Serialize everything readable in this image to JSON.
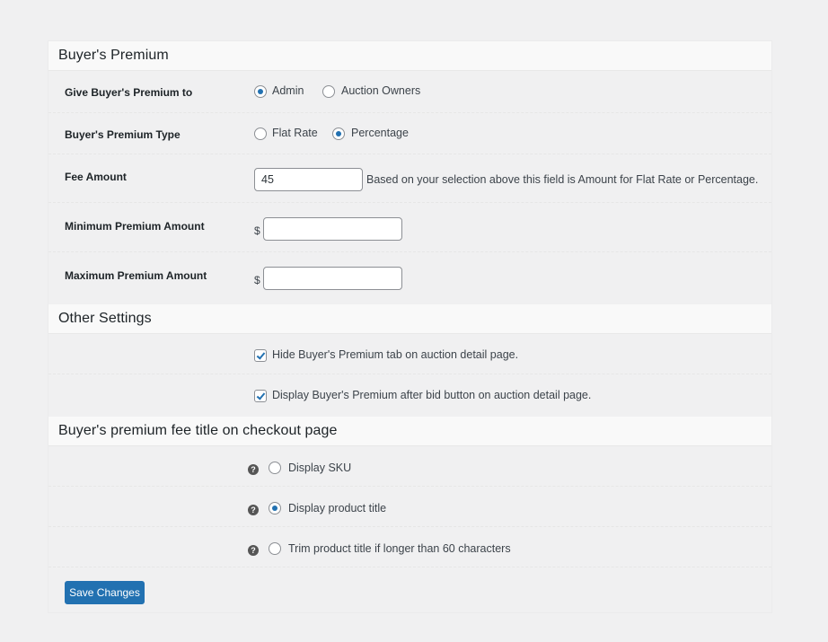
{
  "sections": {
    "buyers_premium": {
      "title": "Buyer's Premium",
      "give_to": {
        "label": "Give Buyer's Premium to",
        "options": [
          {
            "label": "Admin",
            "selected": true
          },
          {
            "label": "Auction Owners",
            "selected": false
          }
        ]
      },
      "type": {
        "label": "Buyer's Premium Type",
        "options": [
          {
            "label": "Flat Rate",
            "selected": false
          },
          {
            "label": "Percentage",
            "selected": true
          }
        ]
      },
      "fee_amount": {
        "label": "Fee Amount",
        "value": "45",
        "description": "Based on your selection above this field is Amount for Flat Rate or Percentage."
      },
      "minimum": {
        "label": "Minimum Premium Amount",
        "currency": "$",
        "value": ""
      },
      "maximum": {
        "label": "Maximum Premium Amount",
        "currency": "$",
        "value": ""
      }
    },
    "other_settings": {
      "title": "Other Settings",
      "checkboxes": [
        {
          "label": "Hide Buyer's Premium tab on auction detail page.",
          "checked": true
        },
        {
          "label": "Display Buyer's Premium after bid button on auction detail page.",
          "checked": true
        }
      ]
    },
    "checkout_title": {
      "title": "Buyer's premium fee title on checkout page",
      "help_icon": "?",
      "options": [
        {
          "label": "Display SKU",
          "selected": false
        },
        {
          "label": "Display product title",
          "selected": true
        },
        {
          "label": "Trim product title if longer than 60 characters",
          "selected": false
        }
      ]
    }
  },
  "actions": {
    "save_label": "Save Changes"
  },
  "colors": {
    "accent": "#2271b1",
    "background": "#f0f0f1",
    "section_header": "#f9f9f9"
  }
}
